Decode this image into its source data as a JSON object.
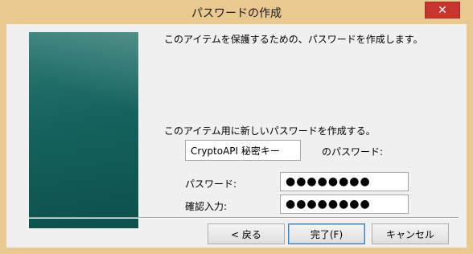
{
  "window": {
    "title": "パスワードの作成",
    "close_symbol": "✕"
  },
  "content": {
    "intro": "このアイテムを保護するための、パスワードを作成します。",
    "prompt": "このアイテム用に新しいパスワードを作成する。",
    "name_value": "CryptoAPI 秘密キー",
    "name_suffix": "のパスワード:",
    "password_label": "パスワード:",
    "password_value": "●●●●●●●●",
    "confirm_label": "確認入力:",
    "confirm_value": "●●●●●●●●"
  },
  "buttons": {
    "back": "< 戻る",
    "finish": "完了(F)",
    "cancel": "キャンセル"
  },
  "colors": {
    "titlebar": "#e9c990",
    "close": "#c7352e",
    "side_image": "#14635e"
  }
}
